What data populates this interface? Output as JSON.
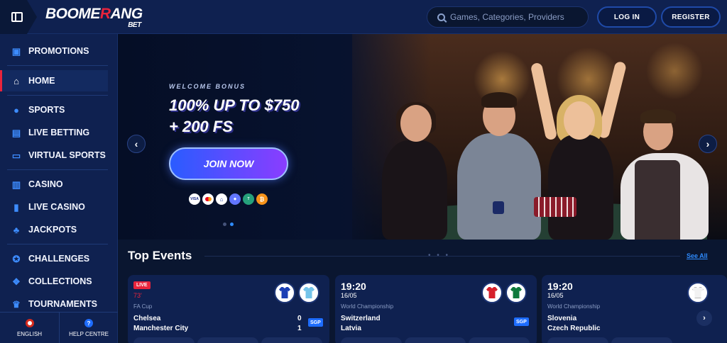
{
  "header": {
    "logo_text_1": "BOOME",
    "logo_text_accent": "R",
    "logo_text_2": "ANG",
    "logo_sub": "BET",
    "search_placeholder": "Games, Categories, Providers",
    "login_label": "LOG IN",
    "register_label": "REGISTER"
  },
  "sidebar": {
    "items": [
      {
        "label": "PROMOTIONS",
        "icon": "gift-icon"
      },
      {
        "label": "HOME",
        "icon": "home-icon",
        "active": true
      },
      {
        "label": "SPORTS",
        "icon": "soccer-ball-icon"
      },
      {
        "label": "LIVE BETTING",
        "icon": "live-tv-icon"
      },
      {
        "label": "VIRTUAL SPORTS",
        "icon": "monitor-icon"
      },
      {
        "label": "CASINO",
        "icon": "slot-machine-icon"
      },
      {
        "label": "LIVE CASINO",
        "icon": "cards-icon"
      },
      {
        "label": "JACKPOTS",
        "icon": "clover-icon"
      },
      {
        "label": "CHALLENGES",
        "icon": "medal-icon"
      },
      {
        "label": "COLLECTIONS",
        "icon": "collection-icon"
      },
      {
        "label": "TOURNAMENTS",
        "icon": "trophy-icon"
      }
    ],
    "footer": {
      "language_label": "ENGLISH",
      "help_label": "HELP CENTRE",
      "help_glyph": "?"
    }
  },
  "banner": {
    "label": "WELCOME BONUS",
    "title_line1": "100% UP TO $750",
    "title_line2": "+ 200 FS",
    "cta_label": "JOIN NOW",
    "payment_methods": [
      "VISA",
      "MC",
      "BANK",
      "ETH",
      "USDT",
      "BTC"
    ],
    "payment_glyphs": {
      "visa": "VISA",
      "bank": "⌂",
      "eth": "◆",
      "usdt": "T",
      "btc": "₿"
    },
    "prev_glyph": "‹",
    "next_glyph": "›",
    "active_slide": 2,
    "slide_count": 2
  },
  "top_events": {
    "title": "Top Events",
    "dots": "• • •",
    "see_all_label": "See All",
    "events": [
      {
        "live_label": "LIVE",
        "minute": "73'",
        "league": "FA Cup",
        "home": "Chelsea",
        "away": "Manchester City",
        "home_score": "0",
        "away_score": "1",
        "badge": "SGP"
      },
      {
        "time": "19:20",
        "date": "16/05",
        "league": "World Championship",
        "home": "Switzerland",
        "away": "Latvia",
        "badge": "SGP"
      },
      {
        "time": "19:20",
        "date": "16/05",
        "league": "World Championship",
        "home": "Slovenia",
        "away": "Czech Republic",
        "next_glyph": "›"
      }
    ]
  },
  "colors": {
    "accent_red": "#e8243c",
    "accent_blue": "#2f8cff",
    "background": "#0a1630",
    "panel": "#0f2150"
  }
}
